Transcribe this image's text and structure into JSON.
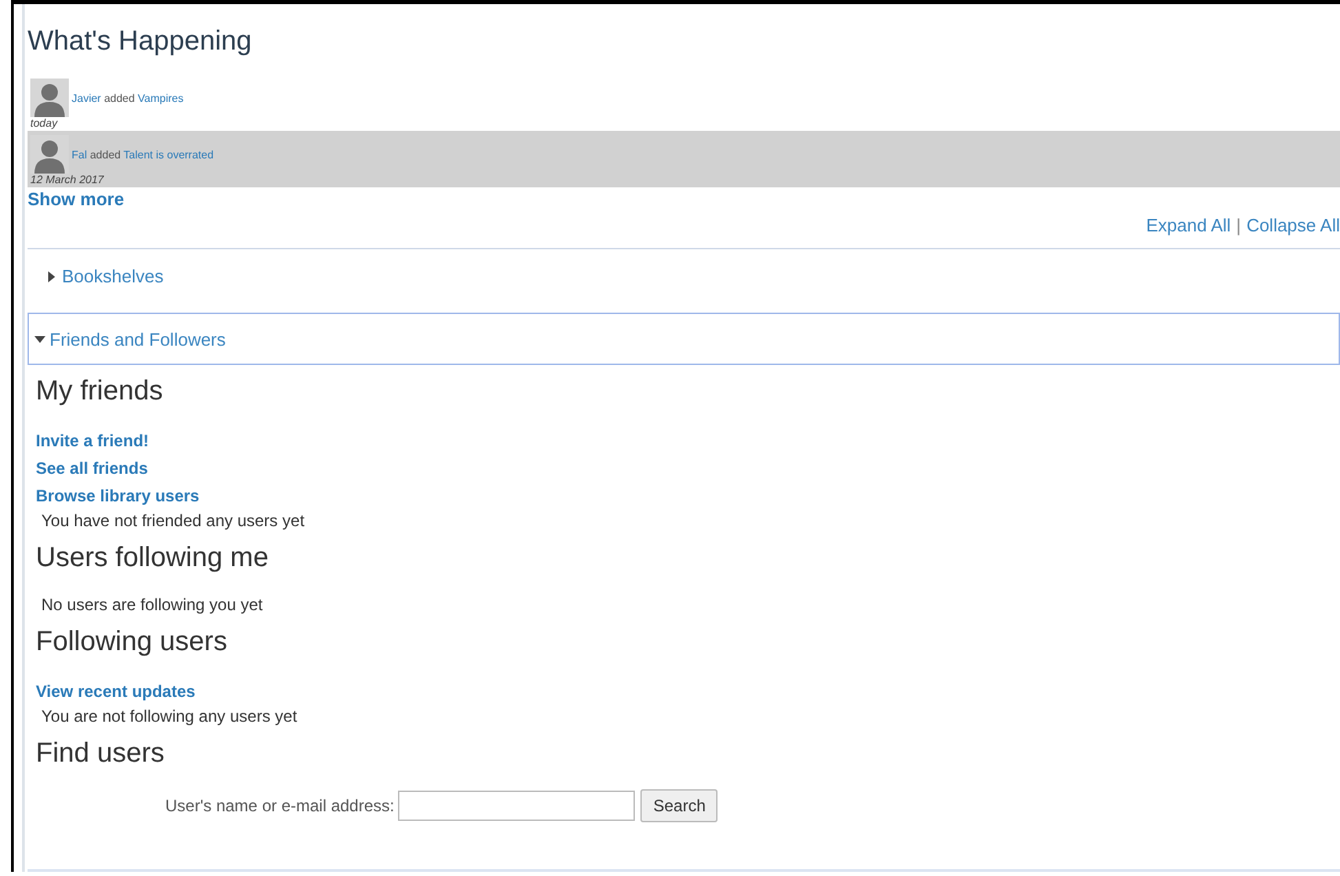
{
  "title": "What's Happening",
  "activity": [
    {
      "actor": "Javier",
      "verb": "added",
      "object": "Vampires",
      "date": "today",
      "highlighted": false
    },
    {
      "actor": "Fal",
      "verb": "added",
      "object": "Talent is overrated",
      "date": "12 March 2017",
      "highlighted": true
    }
  ],
  "show_more": "Show more",
  "toggles": {
    "expand": "Expand All",
    "separator": "|",
    "collapse": "Collapse All"
  },
  "sections": [
    {
      "label": "Bookshelves",
      "expanded": false
    },
    {
      "label": "Friends and Followers",
      "expanded": true
    }
  ],
  "friends": [
    {
      "heading": "My friends",
      "links": [
        "Invite a friend!",
        "See all friends",
        "Browse library users"
      ],
      "note": "You have not friended any users yet"
    },
    {
      "heading": "Users following me",
      "note": "No users are following you yet"
    },
    {
      "heading": "Following users",
      "links": [
        "View recent updates"
      ],
      "note": "You are not following any users yet"
    }
  ],
  "find": {
    "heading": "Find users",
    "label": "User's name or e-mail address:",
    "button": "Search"
  }
}
